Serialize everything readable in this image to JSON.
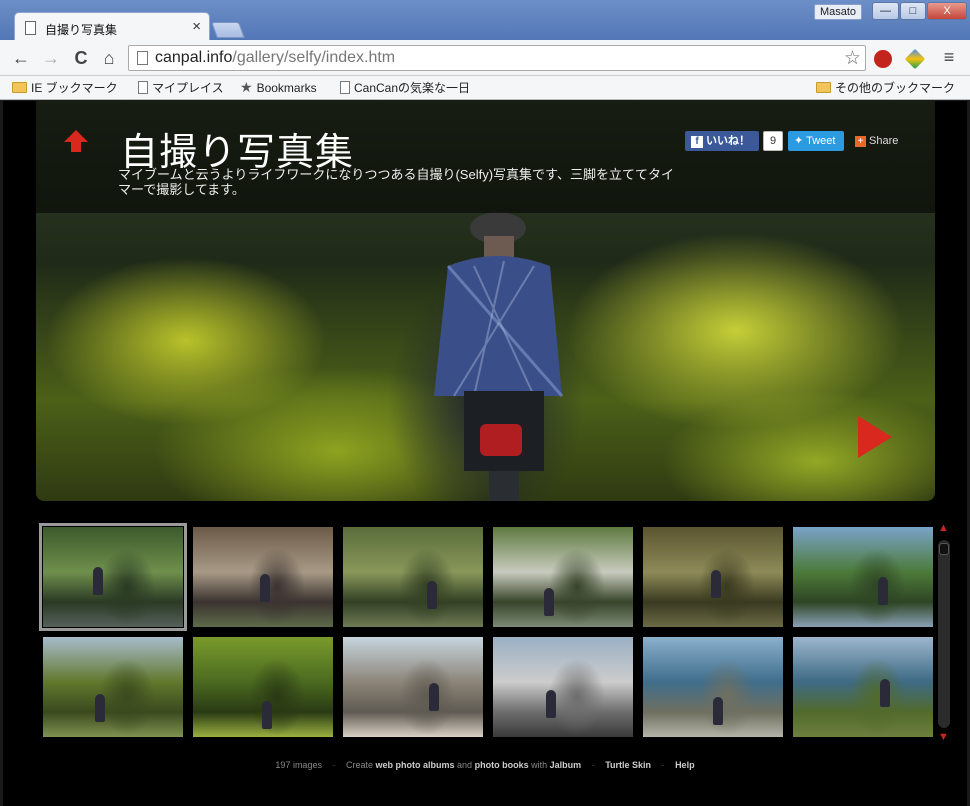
{
  "browser": {
    "tab_title": "自撮り写真集",
    "tab_close": "×",
    "user_name": "Masato",
    "window_buttons": [
      "—",
      "□",
      "X"
    ],
    "url_host": "canpal.info",
    "url_path": "/gallery/selfy/index.htm",
    "nav": {
      "back": "←",
      "forward": "→",
      "reload": "C",
      "home": "⌂"
    },
    "menu_icon": "≡",
    "star_icon": "☆"
  },
  "bookmarks": {
    "items": [
      {
        "label": "IE ブックマーク",
        "icon": "folder-icon"
      },
      {
        "label": "マイプレイス",
        "icon": "page-icon"
      },
      {
        "label": "Bookmarks",
        "icon": "star-icon"
      },
      {
        "label": "CanCanの気楽な一日",
        "icon": "page-icon"
      }
    ],
    "other": "その他のブックマーク"
  },
  "gallery": {
    "title": "自撮り写真集",
    "description": "マイブームと云うよりライフワークになりつつある自撮り(Selfy)写真集です、三脚を立ててタイマーで撮影してます。",
    "social": {
      "like": "いいね！",
      "like_count": "9",
      "tweet": "Tweet",
      "share": "Share"
    },
    "thumbnails": [
      {
        "scene": "road-sign",
        "colors": [
          "#3c5a2c",
          "#6f8f4c",
          "#2a3a24",
          "#55605a"
        ]
      },
      {
        "scene": "village-house",
        "colors": [
          "#6b5a48",
          "#a89a86",
          "#3b3330",
          "#5d6b49"
        ]
      },
      {
        "scene": "mountain-path",
        "colors": [
          "#5a6d3a",
          "#89975a",
          "#324024",
          "#6f7a55"
        ]
      },
      {
        "scene": "river-riders",
        "colors": [
          "#5e7a42",
          "#c8cbbd",
          "#38452b",
          "#7b8a75"
        ]
      },
      {
        "scene": "forest-trail",
        "colors": [
          "#5a5530",
          "#8e8a58",
          "#3a3a20",
          "#6b6a45"
        ]
      },
      {
        "scene": "hill-village",
        "colors": [
          "#7aa3c8",
          "#4d7a3a",
          "#2e4524",
          "#8aa0b5"
        ]
      },
      {
        "scene": "orchard-hills",
        "colors": [
          "#a8bccc",
          "#61782c",
          "#3a4a1e",
          "#7f9350"
        ]
      },
      {
        "scene": "orchard-rider",
        "colors": [
          "#7a9a2c",
          "#4b6a20",
          "#2a3a14",
          "#9ab040"
        ]
      },
      {
        "scene": "coastal-rocks",
        "colors": [
          "#c7d4de",
          "#8c8578",
          "#5f5a52",
          "#d8d0c4"
        ]
      },
      {
        "scene": "arch-bridge",
        "colors": [
          "#9ab0c4",
          "#cccccc",
          "#6d6d6d",
          "#3a3a3a"
        ]
      },
      {
        "scene": "sea-road",
        "colors": [
          "#8ab0cc",
          "#3f6e8c",
          "#6f6f60",
          "#b3b3a8"
        ]
      },
      {
        "scene": "bay-rider",
        "colors": [
          "#9cb6cc",
          "#3e6a84",
          "#526a2c",
          "#6c7f3f"
        ]
      }
    ]
  },
  "footer": {
    "count": "197 images",
    "create": "Create",
    "web_albums": "web photo albums",
    "and": "and",
    "photo_books": "photo books",
    "with": "with",
    "jalbum": "Jalbum",
    "skin": "Turtle Skin",
    "help": "Help",
    "separator": "·"
  },
  "colors": {
    "accent_red": "#d9281e",
    "facebook": "#3b5998",
    "twitter": "#2b9ae0"
  }
}
